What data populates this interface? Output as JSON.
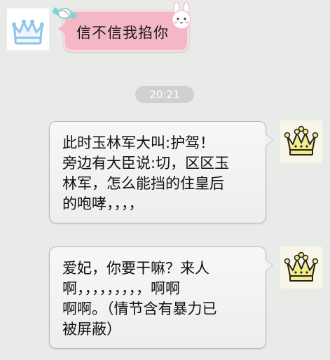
{
  "messages": [
    {
      "side": "left",
      "text": "信不信我掐你",
      "avatar_icon": "crown-outline-icon"
    },
    {
      "side": "right",
      "text": "此时玉林军大叫:护驾！\n旁边有大臣说:切，区区玉\n林军，怎么能挡的住皇后\n的咆哮，，，，",
      "avatar_icon": "crown-gold-icon"
    },
    {
      "side": "right",
      "text": "爱妃，你要干嘛？来人\n啊，，，，，，，，，啊啊\n啊啊。（情节含有暴力已\n被屏蔽）",
      "avatar_icon": "crown-gold-icon"
    }
  ],
  "timestamp": "20:21",
  "colors": {
    "background": "#e9ebe8",
    "pink_bubble": "#f4b7c6",
    "grey_bubble": "#f1f1f1",
    "timestamp_pill": "#cfd1cf"
  }
}
